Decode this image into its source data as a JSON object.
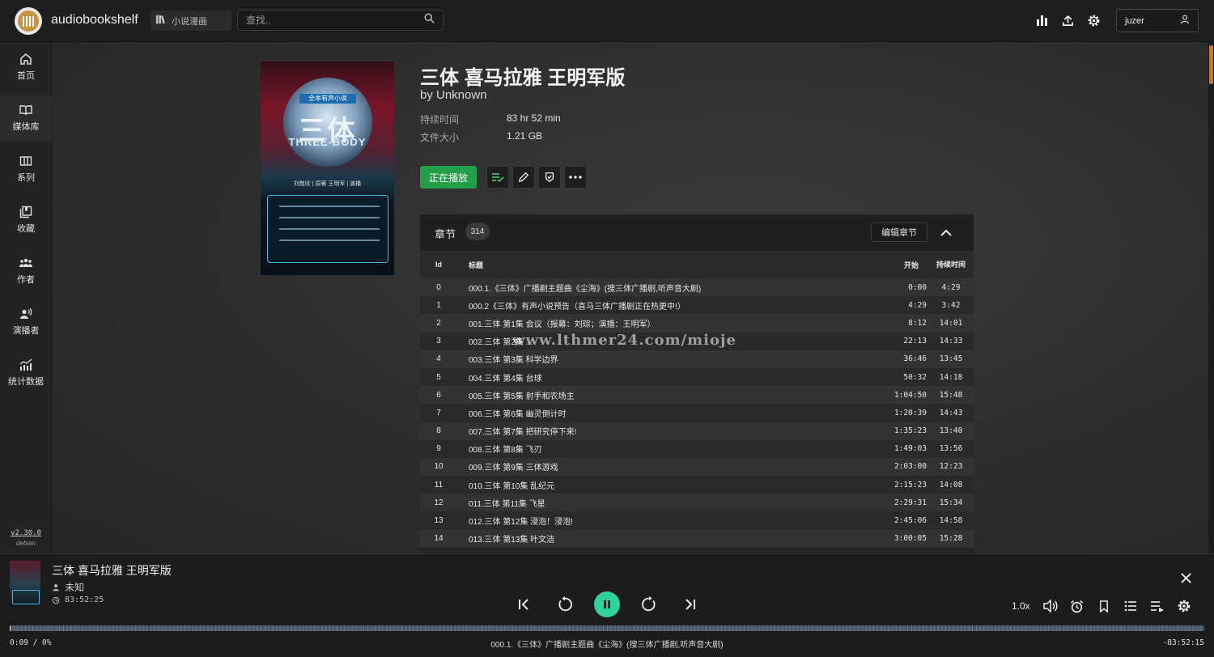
{
  "app": {
    "name": "audiobookshelf"
  },
  "header": {
    "library_name": "小说漫画",
    "search_placeholder": "查找..",
    "username": "juzer"
  },
  "sidebar": {
    "items": [
      {
        "label": "首页",
        "icon": "home-icon"
      },
      {
        "label": "媒体库",
        "icon": "book-open-icon"
      },
      {
        "label": "系列",
        "icon": "columns-icon"
      },
      {
        "label": "收藏",
        "icon": "collection-icon"
      },
      {
        "label": "作者",
        "icon": "users-icon"
      },
      {
        "label": "演播者",
        "icon": "narrator-icon"
      },
      {
        "label": "统计数据",
        "icon": "stats-icon"
      }
    ],
    "version": "v2.30.0",
    "distro": "debian"
  },
  "book": {
    "title": "三体 喜马拉雅 王明军版",
    "author": "by Unknown",
    "duration_label": "持续时间",
    "duration": "83 hr 52 min",
    "size_label": "文件大小",
    "size": "1.21 GB",
    "play_label": "正在播放",
    "cover": {
      "banner": "全本有声小说",
      "title": "三体",
      "title_en": "THREE-BODY",
      "names": "刘慈欣 | 原著   王明军 | 演播"
    }
  },
  "chapters": {
    "label": "章节",
    "count": "314",
    "edit_label": "编辑章节",
    "columns": {
      "id": "Id",
      "title": "标题",
      "start": "开始",
      "duration": "持续时间"
    },
    "rows": [
      {
        "id": "0",
        "title": "000.1.《三体》广播剧主题曲《尘海》(搜三体广播剧,听声音大剧)",
        "start": "0:00",
        "duration": "4:29"
      },
      {
        "id": "1",
        "title": "000.2《三体》有声小说预告（喜马三体广播剧正在热更中!）",
        "start": "4:29",
        "duration": "3:42"
      },
      {
        "id": "2",
        "title": "001.三体 第1集 会议（报幕：刘琮；演播：王明军）",
        "start": "8:12",
        "duration": "14:01"
      },
      {
        "id": "3",
        "title": "002.三体 第2集 ...",
        "start": "22:13",
        "duration": "14:33"
      },
      {
        "id": "4",
        "title": "003.三体 第3集 科学边界",
        "start": "36:46",
        "duration": "13:45"
      },
      {
        "id": "5",
        "title": "004.三体 第4集 台球",
        "start": "50:32",
        "duration": "14:18"
      },
      {
        "id": "6",
        "title": "005.三体 第5集 射手和农场主",
        "start": "1:04:50",
        "duration": "15:48"
      },
      {
        "id": "7",
        "title": "006.三体 第6集 幽灵倒计时",
        "start": "1:20:39",
        "duration": "14:43"
      },
      {
        "id": "8",
        "title": "007.三体 第7集 把研究停下来!",
        "start": "1:35:23",
        "duration": "13:40"
      },
      {
        "id": "9",
        "title": "008.三体 第8集 飞刃",
        "start": "1:49:03",
        "duration": "13:56"
      },
      {
        "id": "10",
        "title": "009.三体 第9集 三体游戏",
        "start": "2:03:00",
        "duration": "12:23"
      },
      {
        "id": "11",
        "title": "010.三体 第10集 乱纪元",
        "start": "2:15:23",
        "duration": "14:08"
      },
      {
        "id": "12",
        "title": "011.三体 第11集 飞星",
        "start": "2:29:31",
        "duration": "15:34"
      },
      {
        "id": "13",
        "title": "012.三体 第12集 浸泡！浸泡!",
        "start": "2:45:06",
        "duration": "14:58"
      },
      {
        "id": "14",
        "title": "013.三体 第13集 叶文洁",
        "start": "3:00:05",
        "duration": "15:28"
      }
    ]
  },
  "watermark": "www.lthmer24.com/mioje",
  "player": {
    "title": "三体 喜马拉雅 王明军版",
    "author": "未知",
    "remaining": "83:52:25",
    "playback_rate": "1.0x",
    "current_time": "0:09 / 0%",
    "current_chapter": "000.1.《三体》广播剧主题曲《尘海》(搜三体广播剧,听声音大剧)",
    "time_left": "-83:52:15",
    "progress_fraction": 0.001
  },
  "colors": {
    "accent": "#23a047",
    "play_button": "#2ed39a",
    "scroll_thumb": "#c17a2e"
  }
}
